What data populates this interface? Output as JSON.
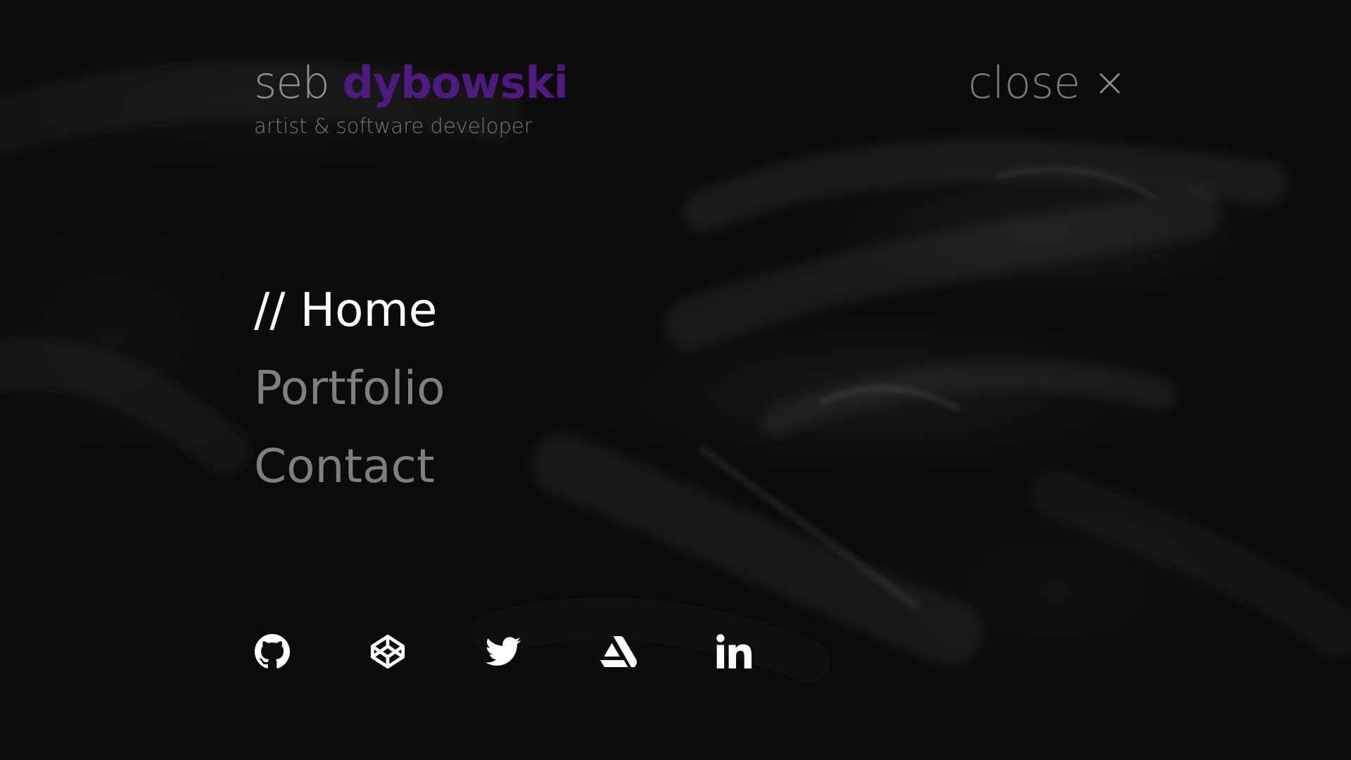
{
  "brand": {
    "first_name": "seb",
    "last_name": "dybowski",
    "tagline": "artist & software developer",
    "accent_color": "#4f1a80"
  },
  "close": {
    "label": "close",
    "icon": "close-icon",
    "glyph": "×"
  },
  "nav": {
    "items": [
      {
        "label": "// Home",
        "active": true
      },
      {
        "label": "Portfolio",
        "active": false
      },
      {
        "label": "Contact",
        "active": false
      }
    ]
  },
  "social": [
    {
      "icon": "github-icon"
    },
    {
      "icon": "codepen-icon"
    },
    {
      "icon": "twitter-icon"
    },
    {
      "icon": "artstation-icon"
    },
    {
      "icon": "linkedin-icon"
    }
  ]
}
